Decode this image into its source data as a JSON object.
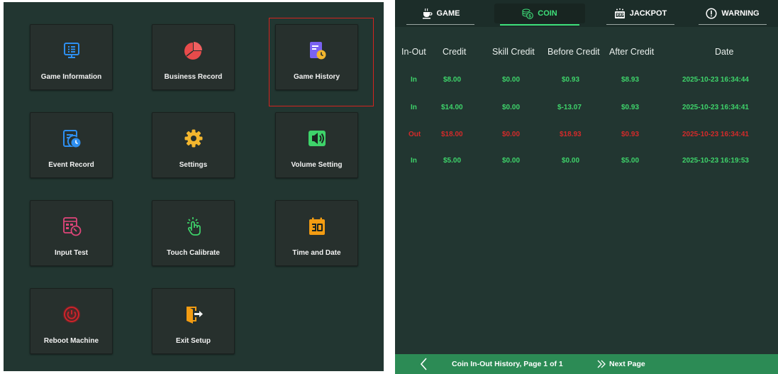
{
  "menu": {
    "tiles": [
      {
        "label": "Game Information",
        "icon": "monitor-list-icon"
      },
      {
        "label": "Business Record",
        "icon": "pie-chart-icon"
      },
      {
        "label": "Game History",
        "icon": "document-clock-icon",
        "selected": true
      },
      {
        "label": "Event Record",
        "icon": "document-clock-icon"
      },
      {
        "label": "Settings",
        "icon": "gear-icon"
      },
      {
        "label": "Volume Setting",
        "icon": "speaker-icon"
      },
      {
        "label": "Input Test",
        "icon": "keypad-dial-icon"
      },
      {
        "label": "Touch Calibrate",
        "icon": "touch-hand-icon"
      },
      {
        "label": "Time and Date",
        "icon": "calendar-icon"
      },
      {
        "label": "Reboot Machine",
        "icon": "power-icon"
      },
      {
        "label": "Exit Setup",
        "icon": "exit-door-icon"
      }
    ]
  },
  "tabs": [
    {
      "label": "GAME",
      "icon": "cup-icon"
    },
    {
      "label": "COIN",
      "icon": "coin-icon",
      "active": true
    },
    {
      "label": "JACKPOT",
      "icon": "slot-777-icon"
    },
    {
      "label": "WARNING",
      "icon": "warning-circle-icon"
    }
  ],
  "table": {
    "columns": [
      "In-Out",
      "Credit",
      "Skill Credit",
      "Before Credit",
      "After Credit",
      "Date"
    ],
    "rows": [
      {
        "type": "In",
        "credit": "$8.00",
        "skill": "$0.00",
        "before": "$0.93",
        "after": "$8.93",
        "date": "2025-10-23 16:34:44"
      },
      {
        "type": "In",
        "credit": "$14.00",
        "skill": "$0.00",
        "before": "$-13.07",
        "after": "$0.93",
        "date": "2025-10-23 16:34:41"
      },
      {
        "type": "Out",
        "credit": "$18.00",
        "skill": "$0.00",
        "before": "$18.93",
        "after": "$0.93",
        "date": "2025-10-23 16:34:41"
      },
      {
        "type": "In",
        "credit": "$5.00",
        "skill": "$0.00",
        "before": "$0.00",
        "after": "$5.00",
        "date": "2025-10-23 16:19:53"
      }
    ]
  },
  "footer": {
    "title": "Coin In-Out History, Page 1 of 1",
    "next_label": "Next Page"
  },
  "colors": {
    "in_text": "#3ed36a",
    "out_text": "#d42a2a",
    "active_tab": "#3ee07a",
    "selection_outline": "#d4241f",
    "footer_bar": "#2c8b55"
  }
}
